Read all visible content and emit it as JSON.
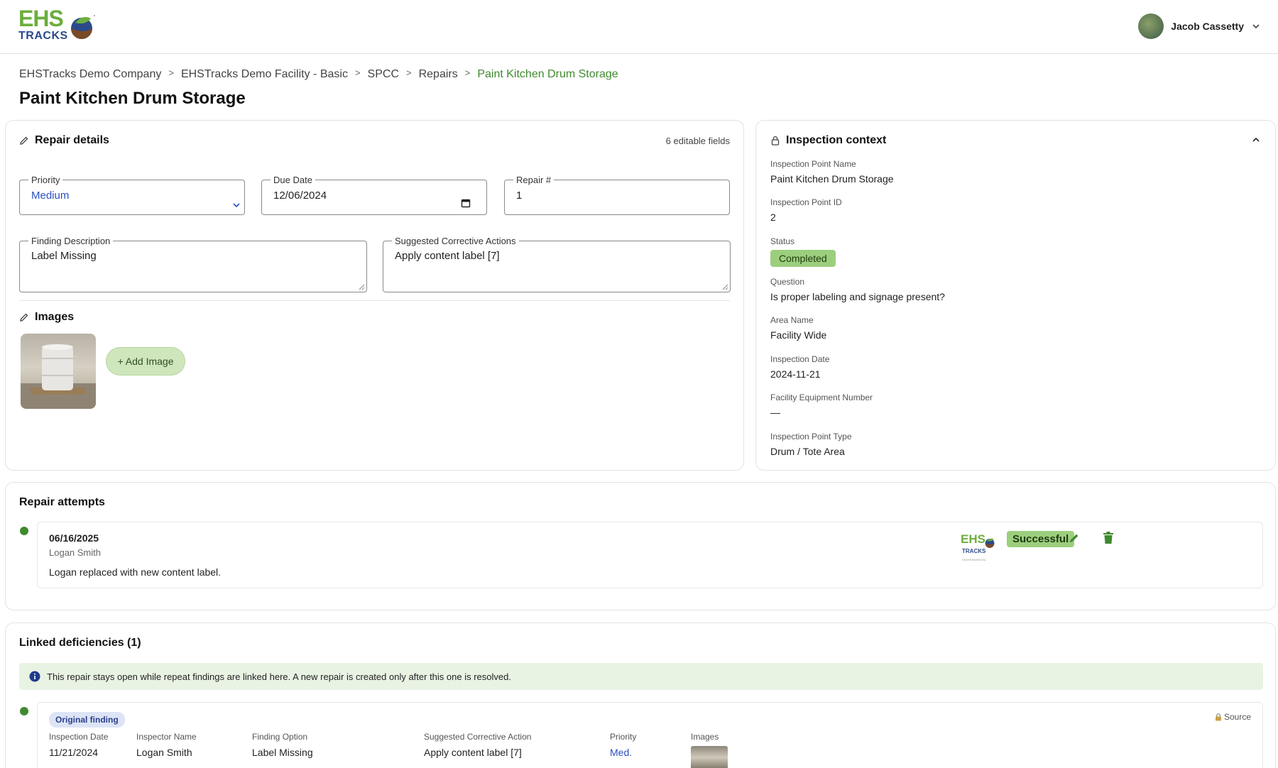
{
  "header": {
    "logo": {
      "ehs": "EHS",
      "tracks": "TRACKS"
    },
    "user_name": "Jacob Cassetty"
  },
  "breadcrumb": {
    "items": [
      "EHSTracks Demo Company",
      "EHSTracks Demo Facility - Basic",
      "SPCC",
      "Repairs",
      "Paint Kitchen Drum Storage"
    ],
    "separator": ">"
  },
  "page_title": "Paint Kitchen Drum Storage",
  "repair_details": {
    "title": "Repair details",
    "editable_count": "6 editable fields",
    "priority": {
      "label": "Priority",
      "value": "Medium"
    },
    "due_date": {
      "label": "Due Date",
      "value": "12/06/2024"
    },
    "repair_no": {
      "label": "Repair #",
      "value": "1"
    },
    "finding_description": {
      "label": "Finding Description",
      "value": "Label Missing"
    },
    "suggested_actions": {
      "label": "Suggested Corrective Actions",
      "value": "Apply content label [7]"
    },
    "images_title": "Images",
    "add_image_label": "+ Add Image"
  },
  "inspection_context": {
    "title": "Inspection context",
    "fields": [
      {
        "label": "Inspection Point Name",
        "value": "Paint Kitchen Drum Storage"
      },
      {
        "label": "Inspection Point ID",
        "value": "2"
      },
      {
        "label": "Status",
        "value": "Completed"
      },
      {
        "label": "Question",
        "value": "Is proper labeling and signage present?"
      },
      {
        "label": "Area Name",
        "value": "Facility Wide"
      },
      {
        "label": "Inspection Date",
        "value": "2024-11-21"
      },
      {
        "label": "Facility Equipment Number",
        "value": "—"
      },
      {
        "label": "Inspection Point Type",
        "value": "Drum / Tote Area"
      }
    ]
  },
  "repair_attempts": {
    "title": "Repair attempts",
    "items": [
      {
        "date": "06/16/2025",
        "person": "Logan Smith",
        "note": "Logan replaced with new content label.",
        "logo": {
          "ehs": "EHS",
          "tracks": "TRACKS",
          "sub": "ENVIRONMENTAL"
        },
        "status": "Successful"
      }
    ]
  },
  "linked_deficiencies": {
    "title": "Linked deficiencies (1)",
    "info": "This repair stays open while repeat findings are linked here. A new repair is created only after this one is resolved.",
    "items": [
      {
        "badge": "Original finding",
        "source_label": "Source",
        "columns": [
          {
            "label": "Inspection Date",
            "value": "11/21/2024"
          },
          {
            "label": "Inspector Name",
            "value": "Logan Smith"
          },
          {
            "label": "Finding Option",
            "value": "Label Missing"
          },
          {
            "label": "Suggested Corrective Action",
            "value": "Apply content label [7]"
          },
          {
            "label": "Priority",
            "value": "Med."
          },
          {
            "label": "Images",
            "value": ""
          }
        ]
      }
    ]
  },
  "colors": {
    "accent_green": "#3f8a2e",
    "badge_green": "#9ccf7d",
    "link_blue": "#2a4fbf",
    "info_bg": "#e9f3e4"
  }
}
